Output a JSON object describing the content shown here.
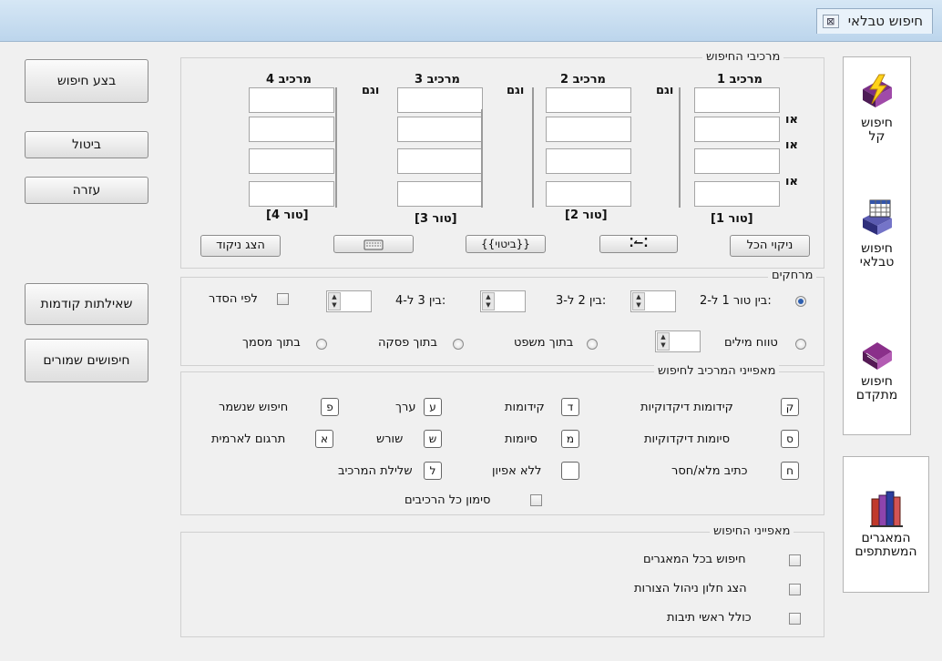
{
  "window": {
    "title": "חיפוש טבלאי",
    "close_glyph": "⊠"
  },
  "left_buttons": {
    "search": "בצע חיפוש",
    "cancel": "ביטול",
    "help": "עזרה",
    "previous_queries": "שאילתות קודמות",
    "saved_searches": "חיפושים שמורים"
  },
  "components": {
    "legend": "מרכיבי החיפוש",
    "columns": [
      {
        "header": "מרכיב 1",
        "footer": "[טור 1]"
      },
      {
        "header": "מרכיב 2",
        "footer": "[טור 2]"
      },
      {
        "header": "מרכיב 3",
        "footer": "[טור 3]"
      },
      {
        "header": "מרכיב 4",
        "footer": "[טור 4]"
      }
    ],
    "and_label": "וגם",
    "or_label": "או",
    "clear_all": "ניקוי הכל",
    "expressions": "{{ביטוי}}",
    "show_vowels": "הצג ניקוד"
  },
  "distances": {
    "legend": "מרחקים",
    "col1_2": "בין טור 1 ל-2:",
    "col2_3": "בין 2 ל-3:",
    "col3_4": "בין 3 ל-4:",
    "in_order": "לפי הסדר",
    "word_range": "טווח מילים",
    "in_sentence": "בתוך משפט",
    "in_paragraph": "בתוך פסקה",
    "in_document": "בתוך מסמך"
  },
  "features": {
    "legend": "מאפייני המרכיב לחיפוש",
    "items": [
      {
        "key": "ק",
        "label": "קידומות דיקדוקיות"
      },
      {
        "key": "ד",
        "label": "קידומות"
      },
      {
        "key": "ע",
        "label": "ערך"
      },
      {
        "key": "פ",
        "label": "חיפוש שנשמר"
      },
      {
        "key": "ס",
        "label": "סיומות דיקדוקיות"
      },
      {
        "key": "מ",
        "label": "סיומות"
      },
      {
        "key": "ש",
        "label": "שורש"
      },
      {
        "key": "א",
        "label": "תרגום לארמית"
      },
      {
        "key": "ח",
        "label": "כתיב מלא/חסר"
      },
      {
        "key": "",
        "label": "ללא אפיון"
      },
      {
        "key": "ל",
        "label": "שלילת המרכיב"
      }
    ],
    "mark_all": "סימון כל הרכיבים"
  },
  "search_features": {
    "legend": "מאפייני החיפוש",
    "all_repos": "חיפוש בכל המאגרים",
    "show_forms": "הצג חלון ניהול הצורות",
    "include_acronyms": "כולל ראשי תיבות"
  },
  "sidebar": [
    {
      "line1": "חיפוש",
      "line2": "קל",
      "icon": "lightning-book-icon"
    },
    {
      "line1": "חיפוש",
      "line2": "טבלאי",
      "icon": "table-book-icon"
    },
    {
      "line1": "חיפוש",
      "line2": "מתקדם",
      "icon": "purple-book-icon"
    },
    {
      "line1": "המאגרים",
      "line2": "המשתתפים",
      "icon": "books-icon"
    }
  ]
}
